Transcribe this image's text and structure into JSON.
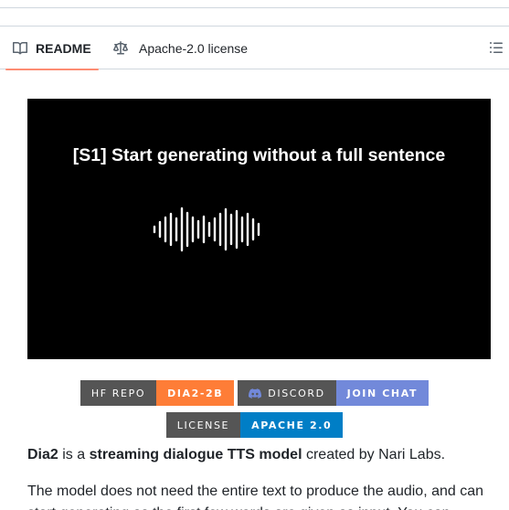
{
  "tabs": {
    "readme_label": "README",
    "license_label": "Apache-2.0 license"
  },
  "video": {
    "caption": "[S1] Start generating without a full sentence"
  },
  "badges": {
    "hf_left": "HF REPO",
    "hf_right": "DIA2-2B",
    "hf_color": "#fe7d37",
    "discord_left": "DISCORD",
    "discord_right": "JOIN CHAT",
    "discord_color": "#7289da",
    "license_left": "LICENSE",
    "license_right": "APACHE 2.0",
    "license_color": "#007ec6"
  },
  "readme": {
    "p1_name": "Dia2",
    "p1_a": " is a ",
    "p1_bold": "streaming dialogue TTS model",
    "p1_b": " created by Nari Labs.",
    "p2": "The model does not need the entire text to produce the audio, and can start generating as the first few words are given as input. You can"
  },
  "icons": {
    "readme": "book-icon",
    "license": "scale-icon",
    "toc": "list-icon",
    "discord": "discord-icon",
    "waveform": "waveform-icon"
  }
}
